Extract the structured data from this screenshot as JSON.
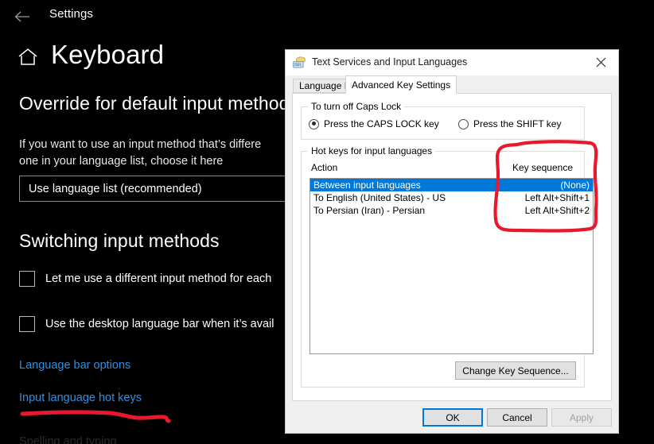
{
  "settings": {
    "back_icon": "back-arrow-icon",
    "app_name": "Settings",
    "home_icon": "home-icon",
    "page_title": "Keyboard",
    "override_heading": "Override for default input method",
    "override_desc_line1": "If you want to use an input method that’s differe",
    "override_desc_line2": "one in your language list, choose it here",
    "language_combo_value": "Use language list (recommended)",
    "switching_heading": "Switching input methods",
    "checkbox1_label": "Let me use a different input method for each",
    "checkbox2_label": "Use the desktop language bar when it’s avail",
    "link_language_bar": "Language bar options",
    "link_hot_keys": "Input language hot keys",
    "faint_bottom_text": "Spelling and typing",
    "link_color": "#2f8fe0",
    "background": "#000000"
  },
  "dialog": {
    "icon": "keyboard-language-icon",
    "title": "Text Services and Input Languages",
    "close_icon": "close-icon",
    "tabs": [
      {
        "label": "Language Bar",
        "active": false
      },
      {
        "label": "Advanced Key Settings",
        "active": true
      }
    ],
    "caps_group": {
      "legend": "To turn off Caps Lock",
      "options": [
        {
          "label": "Press the CAPS LOCK key",
          "selected": true
        },
        {
          "label": "Press the SHIFT key",
          "selected": false
        }
      ]
    },
    "hotkeys_group": {
      "legend": "Hot keys for input languages",
      "columns": [
        "Action",
        "Key sequence"
      ],
      "rows": [
        {
          "action": "Between input languages",
          "sequence": "(None)",
          "selected": true
        },
        {
          "action": "To English (United States) - US",
          "sequence": "Left Alt+Shift+1",
          "selected": false
        },
        {
          "action": "To Persian (Iran) - Persian",
          "sequence": "Left Alt+Shift+2",
          "selected": false
        }
      ],
      "change_button": "Change Key Sequence..."
    },
    "footer_buttons": [
      {
        "label": "OK",
        "state": "default"
      },
      {
        "label": "Cancel",
        "state": "normal"
      },
      {
        "label": "Apply",
        "state": "disabled"
      }
    ],
    "selection_color": "#0078d7"
  },
  "annotations": {
    "ink_color": "#e8192c",
    "circle_label": "hand-drawn-circle-around-key-sequence-column",
    "underline_label": "hand-drawn-underline-under-input-language-hot-keys"
  }
}
